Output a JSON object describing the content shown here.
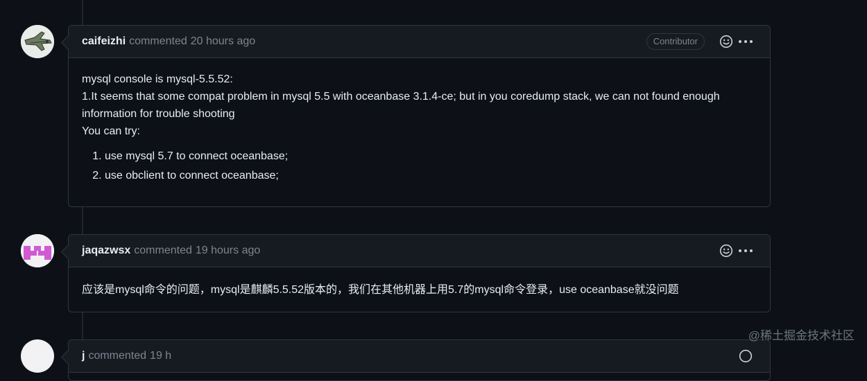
{
  "comments": [
    {
      "author": "caifeizhi",
      "verb": "commented",
      "time": "20 hours ago",
      "badge": "Contributor",
      "body": {
        "line1": "mysql console is mysql-5.5.52:",
        "line2": "1.It seems that some compat problem in mysql 5.5 with oceanbase 3.1.4-ce; but in you coredump stack, we can not found enough information for trouble shooting",
        "line3": "You can try:",
        "list": [
          "use mysql 5.7 to connect oceanbase;",
          "use obclient to connect oceanbase;"
        ]
      }
    },
    {
      "author": "jaqazwsx",
      "verb": "commented",
      "time": "19 hours ago",
      "body": {
        "line1": "应该是mysql命令的问题，mysql是麒麟5.5.52版本的，我们在其他机器上用5.7的mysql命令登录，use oceanbase就没问题"
      }
    },
    {
      "author": "j",
      "verb": "commented",
      "time": "19 h"
    }
  ],
  "watermark": "@稀土掘金技术社区",
  "icons": [
    "smiley-icon",
    "kebab-horizontal-icon"
  ],
  "colors": {
    "background": "#0d1117",
    "header": "#161b22",
    "border": "#30363d",
    "muted": "#7d8590",
    "text": "#e6edf3"
  }
}
